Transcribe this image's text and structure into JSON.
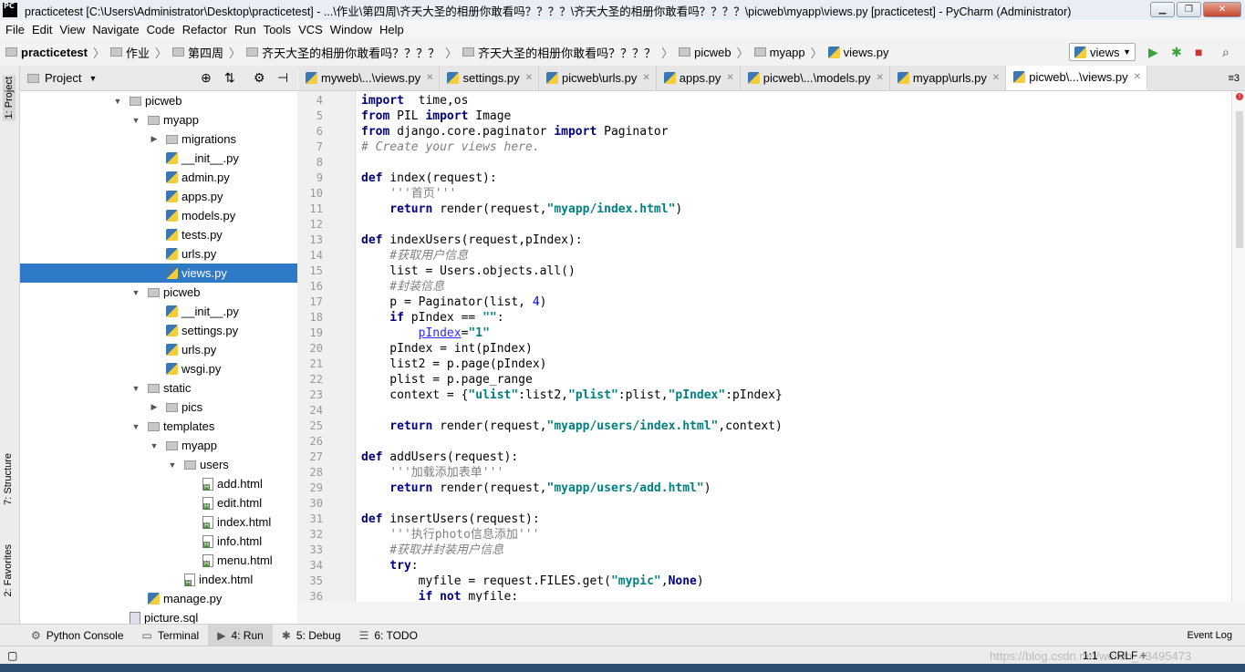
{
  "window": {
    "app_badge": "PC",
    "title": "practicetest [C:\\Users\\Administrator\\Desktop\\practicetest] - ...\\作业\\第四周\\齐天大圣的相册你敢看吗？？？？\\齐天大圣的相册你敢看吗？？？？\\picweb\\myapp\\views.py [practicetest] - PyCharm (Administrator)"
  },
  "menu": [
    "File",
    "Edit",
    "View",
    "Navigate",
    "Code",
    "Refactor",
    "Run",
    "Tools",
    "VCS",
    "Window",
    "Help"
  ],
  "breadcrumb": [
    "practicetest",
    "作业",
    "第四周",
    "齐天大圣的相册你敢看吗？？？？",
    "齐天大圣的相册你敢看吗？？？？",
    "picweb",
    "myapp",
    "views.py"
  ],
  "run_config": "views",
  "left_stripe": {
    "project": "1: Project",
    "structure": "7: Structure",
    "favorites": "2: Favorites"
  },
  "project_panel": {
    "title": "Project"
  },
  "tree": [
    {
      "label": "picweb",
      "icon": "folder",
      "depth": 1,
      "arrow": "down"
    },
    {
      "label": "myapp",
      "icon": "folder",
      "depth": 2,
      "arrow": "down"
    },
    {
      "label": "migrations",
      "icon": "folder",
      "depth": 3,
      "arrow": "right"
    },
    {
      "label": "__init__.py",
      "icon": "py",
      "depth": 3,
      "arrow": ""
    },
    {
      "label": "admin.py",
      "icon": "py",
      "depth": 3,
      "arrow": ""
    },
    {
      "label": "apps.py",
      "icon": "py",
      "depth": 3,
      "arrow": ""
    },
    {
      "label": "models.py",
      "icon": "py",
      "depth": 3,
      "arrow": ""
    },
    {
      "label": "tests.py",
      "icon": "py",
      "depth": 3,
      "arrow": ""
    },
    {
      "label": "urls.py",
      "icon": "py",
      "depth": 3,
      "arrow": ""
    },
    {
      "label": "views.py",
      "icon": "py",
      "depth": 3,
      "arrow": "",
      "selected": true
    },
    {
      "label": "picweb",
      "icon": "folder",
      "depth": 2,
      "arrow": "down"
    },
    {
      "label": "__init__.py",
      "icon": "py",
      "depth": 3,
      "arrow": ""
    },
    {
      "label": "settings.py",
      "icon": "py",
      "depth": 3,
      "arrow": ""
    },
    {
      "label": "urls.py",
      "icon": "py",
      "depth": 3,
      "arrow": ""
    },
    {
      "label": "wsgi.py",
      "icon": "py",
      "depth": 3,
      "arrow": ""
    },
    {
      "label": "static",
      "icon": "folder",
      "depth": 2,
      "arrow": "down"
    },
    {
      "label": "pics",
      "icon": "folder",
      "depth": 3,
      "arrow": "right"
    },
    {
      "label": "templates",
      "icon": "folder",
      "depth": 2,
      "arrow": "down"
    },
    {
      "label": "myapp",
      "icon": "folder",
      "depth": 3,
      "arrow": "down"
    },
    {
      "label": "users",
      "icon": "folder",
      "depth": 4,
      "arrow": "down"
    },
    {
      "label": "add.html",
      "icon": "html",
      "depth": 5,
      "arrow": ""
    },
    {
      "label": "edit.html",
      "icon": "html",
      "depth": 5,
      "arrow": ""
    },
    {
      "label": "index.html",
      "icon": "html",
      "depth": 5,
      "arrow": ""
    },
    {
      "label": "info.html",
      "icon": "html",
      "depth": 5,
      "arrow": ""
    },
    {
      "label": "menu.html",
      "icon": "html",
      "depth": 5,
      "arrow": ""
    },
    {
      "label": "index.html",
      "icon": "html",
      "depth": 4,
      "arrow": ""
    },
    {
      "label": "manage.py",
      "icon": "py",
      "depth": 2,
      "arrow": ""
    },
    {
      "label": "picture.sql",
      "icon": "sql",
      "depth": 1,
      "arrow": ""
    }
  ],
  "tabs": [
    {
      "label": "myweb\\...\\views.py",
      "active": false
    },
    {
      "label": "settings.py",
      "active": false
    },
    {
      "label": "picweb\\urls.py",
      "active": false
    },
    {
      "label": "apps.py",
      "active": false
    },
    {
      "label": "picweb\\...\\models.py",
      "active": false
    },
    {
      "label": "myapp\\urls.py",
      "active": false
    },
    {
      "label": "picweb\\...\\views.py",
      "active": true
    }
  ],
  "tabs_overflow": "≡3",
  "code": [
    {
      "n": "4",
      "t": [
        [
          "kw",
          "import"
        ],
        [
          "",
          "  time,os"
        ]
      ]
    },
    {
      "n": "5",
      "t": [
        [
          "kw",
          "from"
        ],
        [
          "",
          " PIL "
        ],
        [
          "kw",
          "import"
        ],
        [
          "",
          " Image"
        ]
      ]
    },
    {
      "n": "6",
      "t": [
        [
          "kw",
          "from"
        ],
        [
          "",
          " django.core.paginator "
        ],
        [
          "kw",
          "import"
        ],
        [
          "",
          " Paginator"
        ]
      ]
    },
    {
      "n": "7",
      "t": [
        [
          "cm",
          "# Create your views here."
        ]
      ]
    },
    {
      "n": "8",
      "t": []
    },
    {
      "n": "9",
      "t": [
        [
          "kw",
          "def"
        ],
        [
          "",
          " index(request):"
        ]
      ]
    },
    {
      "n": "10",
      "t": [
        [
          "doc",
          "    '''首页'''"
        ]
      ]
    },
    {
      "n": "11",
      "t": [
        [
          "kw",
          "    return"
        ],
        [
          "",
          " render(request,"
        ],
        [
          "str",
          "\"myapp/index.html\""
        ],
        [
          "",
          ")"
        ]
      ]
    },
    {
      "n": "12",
      "t": []
    },
    {
      "n": "13",
      "t": [
        [
          "kw",
          "def"
        ],
        [
          "",
          " indexUsers(request,pIndex):"
        ]
      ]
    },
    {
      "n": "14",
      "t": [
        [
          "cm",
          "    #获取用户信息"
        ]
      ]
    },
    {
      "n": "15",
      "t": [
        [
          "",
          "    list = Users.objects.all()"
        ]
      ]
    },
    {
      "n": "16",
      "t": [
        [
          "cm",
          "    #封装信息"
        ]
      ]
    },
    {
      "n": "17",
      "t": [
        [
          "",
          "    p = Paginator(list, "
        ],
        [
          "num",
          "4"
        ],
        [
          "",
          ")"
        ]
      ]
    },
    {
      "n": "18",
      "t": [
        [
          "kw",
          "    if"
        ],
        [
          "",
          " pIndex == "
        ],
        [
          "str",
          "\"\""
        ],
        [
          "",
          ":"
        ]
      ]
    },
    {
      "n": "19",
      "t": [
        [
          "",
          "        "
        ],
        [
          "ul",
          "pIndex"
        ],
        [
          "",
          "="
        ],
        [
          "str",
          "\"1\""
        ]
      ]
    },
    {
      "n": "20",
      "t": [
        [
          "",
          "    pIndex = int(pIndex)"
        ]
      ]
    },
    {
      "n": "21",
      "t": [
        [
          "",
          "    list2 = p.page(pIndex)"
        ]
      ]
    },
    {
      "n": "22",
      "t": [
        [
          "",
          "    plist = p.page_range"
        ]
      ]
    },
    {
      "n": "23",
      "t": [
        [
          "",
          "    context = {"
        ],
        [
          "str",
          "\"ulist\""
        ],
        [
          "",
          ":list2,"
        ],
        [
          "str",
          "\"plist\""
        ],
        [
          "",
          ":plist,"
        ],
        [
          "str",
          "\"pIndex\""
        ],
        [
          "",
          ":pIndex}"
        ]
      ]
    },
    {
      "n": "24",
      "t": []
    },
    {
      "n": "25",
      "t": [
        [
          "kw",
          "    return"
        ],
        [
          "",
          " render(request,"
        ],
        [
          "str",
          "\"myapp/users/index.html\""
        ],
        [
          "",
          ",context)"
        ]
      ]
    },
    {
      "n": "26",
      "t": []
    },
    {
      "n": "27",
      "t": [
        [
          "kw",
          "def"
        ],
        [
          "",
          " addUsers(request):"
        ]
      ]
    },
    {
      "n": "28",
      "t": [
        [
          "doc",
          "    '''加载添加表单'''"
        ]
      ]
    },
    {
      "n": "29",
      "t": [
        [
          "kw",
          "    return"
        ],
        [
          "",
          " render(request,"
        ],
        [
          "str",
          "\"myapp/users/add.html\""
        ],
        [
          "",
          ")"
        ]
      ]
    },
    {
      "n": "30",
      "t": []
    },
    {
      "n": "31",
      "t": [
        [
          "kw",
          "def"
        ],
        [
          "",
          " insertUsers(request):"
        ]
      ]
    },
    {
      "n": "32",
      "t": [
        [
          "doc",
          "    '''执行photo信息添加'''"
        ]
      ]
    },
    {
      "n": "33",
      "t": [
        [
          "cm",
          "    #获取并封装用户信息"
        ]
      ]
    },
    {
      "n": "34",
      "t": [
        [
          "kw",
          "    try"
        ],
        [
          "",
          ":"
        ]
      ]
    },
    {
      "n": "35",
      "t": [
        [
          "",
          "        myfile = request.FILES.get("
        ],
        [
          "str",
          "\"mypic\""
        ],
        [
          "",
          ","
        ],
        [
          "kw",
          "None"
        ],
        [
          "",
          ")"
        ]
      ]
    },
    {
      "n": "36",
      "t": [
        [
          "kw",
          "        if not"
        ],
        [
          "",
          " myfile:"
        ]
      ]
    }
  ],
  "bottom_tabs": [
    {
      "label": "Python Console",
      "icon": "console-icon"
    },
    {
      "label": "Terminal",
      "icon": "terminal-icon"
    },
    {
      "label": "4: Run",
      "icon": "run-icon",
      "active": true
    },
    {
      "label": "5: Debug",
      "icon": "debug-icon"
    },
    {
      "label": "6: TODO",
      "icon": "todo-icon"
    }
  ],
  "event_log": "Event Log",
  "status": {
    "position": "1:1",
    "line_sep": "CRLF ÷",
    "watermark": "https://blog.csdn.net/weixin_43495473"
  }
}
